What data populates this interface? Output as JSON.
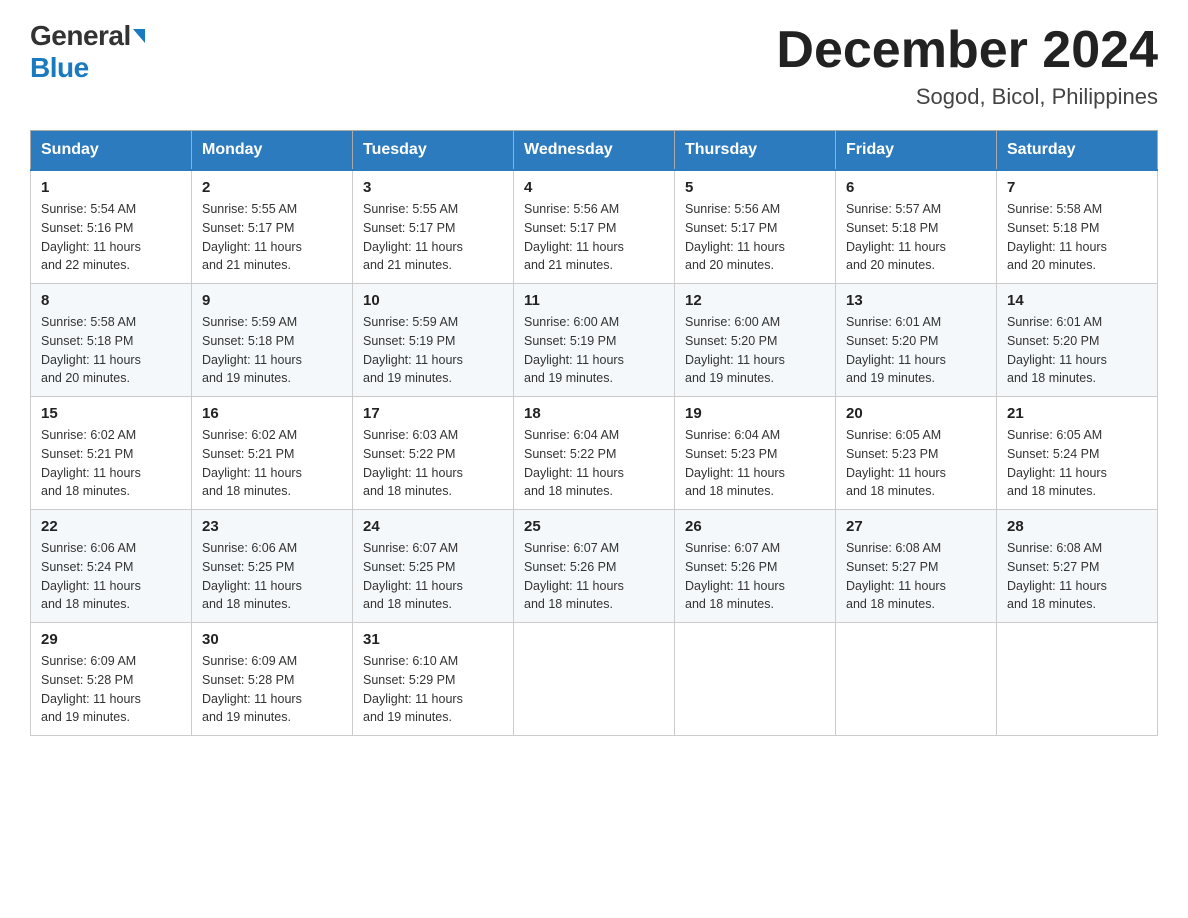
{
  "logo": {
    "general": "General",
    "blue": "Blue"
  },
  "title": {
    "month_year": "December 2024",
    "location": "Sogod, Bicol, Philippines"
  },
  "headers": [
    "Sunday",
    "Monday",
    "Tuesday",
    "Wednesday",
    "Thursday",
    "Friday",
    "Saturday"
  ],
  "weeks": [
    [
      {
        "day": "1",
        "sunrise": "5:54 AM",
        "sunset": "5:16 PM",
        "daylight": "11 hours and 22 minutes."
      },
      {
        "day": "2",
        "sunrise": "5:55 AM",
        "sunset": "5:17 PM",
        "daylight": "11 hours and 21 minutes."
      },
      {
        "day": "3",
        "sunrise": "5:55 AM",
        "sunset": "5:17 PM",
        "daylight": "11 hours and 21 minutes."
      },
      {
        "day": "4",
        "sunrise": "5:56 AM",
        "sunset": "5:17 PM",
        "daylight": "11 hours and 21 minutes."
      },
      {
        "day": "5",
        "sunrise": "5:56 AM",
        "sunset": "5:17 PM",
        "daylight": "11 hours and 20 minutes."
      },
      {
        "day": "6",
        "sunrise": "5:57 AM",
        "sunset": "5:18 PM",
        "daylight": "11 hours and 20 minutes."
      },
      {
        "day": "7",
        "sunrise": "5:58 AM",
        "sunset": "5:18 PM",
        "daylight": "11 hours and 20 minutes."
      }
    ],
    [
      {
        "day": "8",
        "sunrise": "5:58 AM",
        "sunset": "5:18 PM",
        "daylight": "11 hours and 20 minutes."
      },
      {
        "day": "9",
        "sunrise": "5:59 AM",
        "sunset": "5:18 PM",
        "daylight": "11 hours and 19 minutes."
      },
      {
        "day": "10",
        "sunrise": "5:59 AM",
        "sunset": "5:19 PM",
        "daylight": "11 hours and 19 minutes."
      },
      {
        "day": "11",
        "sunrise": "6:00 AM",
        "sunset": "5:19 PM",
        "daylight": "11 hours and 19 minutes."
      },
      {
        "day": "12",
        "sunrise": "6:00 AM",
        "sunset": "5:20 PM",
        "daylight": "11 hours and 19 minutes."
      },
      {
        "day": "13",
        "sunrise": "6:01 AM",
        "sunset": "5:20 PM",
        "daylight": "11 hours and 19 minutes."
      },
      {
        "day": "14",
        "sunrise": "6:01 AM",
        "sunset": "5:20 PM",
        "daylight": "11 hours and 18 minutes."
      }
    ],
    [
      {
        "day": "15",
        "sunrise": "6:02 AM",
        "sunset": "5:21 PM",
        "daylight": "11 hours and 18 minutes."
      },
      {
        "day": "16",
        "sunrise": "6:02 AM",
        "sunset": "5:21 PM",
        "daylight": "11 hours and 18 minutes."
      },
      {
        "day": "17",
        "sunrise": "6:03 AM",
        "sunset": "5:22 PM",
        "daylight": "11 hours and 18 minutes."
      },
      {
        "day": "18",
        "sunrise": "6:04 AM",
        "sunset": "5:22 PM",
        "daylight": "11 hours and 18 minutes."
      },
      {
        "day": "19",
        "sunrise": "6:04 AM",
        "sunset": "5:23 PM",
        "daylight": "11 hours and 18 minutes."
      },
      {
        "day": "20",
        "sunrise": "6:05 AM",
        "sunset": "5:23 PM",
        "daylight": "11 hours and 18 minutes."
      },
      {
        "day": "21",
        "sunrise": "6:05 AM",
        "sunset": "5:24 PM",
        "daylight": "11 hours and 18 minutes."
      }
    ],
    [
      {
        "day": "22",
        "sunrise": "6:06 AM",
        "sunset": "5:24 PM",
        "daylight": "11 hours and 18 minutes."
      },
      {
        "day": "23",
        "sunrise": "6:06 AM",
        "sunset": "5:25 PM",
        "daylight": "11 hours and 18 minutes."
      },
      {
        "day": "24",
        "sunrise": "6:07 AM",
        "sunset": "5:25 PM",
        "daylight": "11 hours and 18 minutes."
      },
      {
        "day": "25",
        "sunrise": "6:07 AM",
        "sunset": "5:26 PM",
        "daylight": "11 hours and 18 minutes."
      },
      {
        "day": "26",
        "sunrise": "6:07 AM",
        "sunset": "5:26 PM",
        "daylight": "11 hours and 18 minutes."
      },
      {
        "day": "27",
        "sunrise": "6:08 AM",
        "sunset": "5:27 PM",
        "daylight": "11 hours and 18 minutes."
      },
      {
        "day": "28",
        "sunrise": "6:08 AM",
        "sunset": "5:27 PM",
        "daylight": "11 hours and 18 minutes."
      }
    ],
    [
      {
        "day": "29",
        "sunrise": "6:09 AM",
        "sunset": "5:28 PM",
        "daylight": "11 hours and 19 minutes."
      },
      {
        "day": "30",
        "sunrise": "6:09 AM",
        "sunset": "5:28 PM",
        "daylight": "11 hours and 19 minutes."
      },
      {
        "day": "31",
        "sunrise": "6:10 AM",
        "sunset": "5:29 PM",
        "daylight": "11 hours and 19 minutes."
      },
      null,
      null,
      null,
      null
    ]
  ],
  "labels": {
    "sunrise": "Sunrise: ",
    "sunset": "Sunset: ",
    "daylight": "Daylight: "
  }
}
